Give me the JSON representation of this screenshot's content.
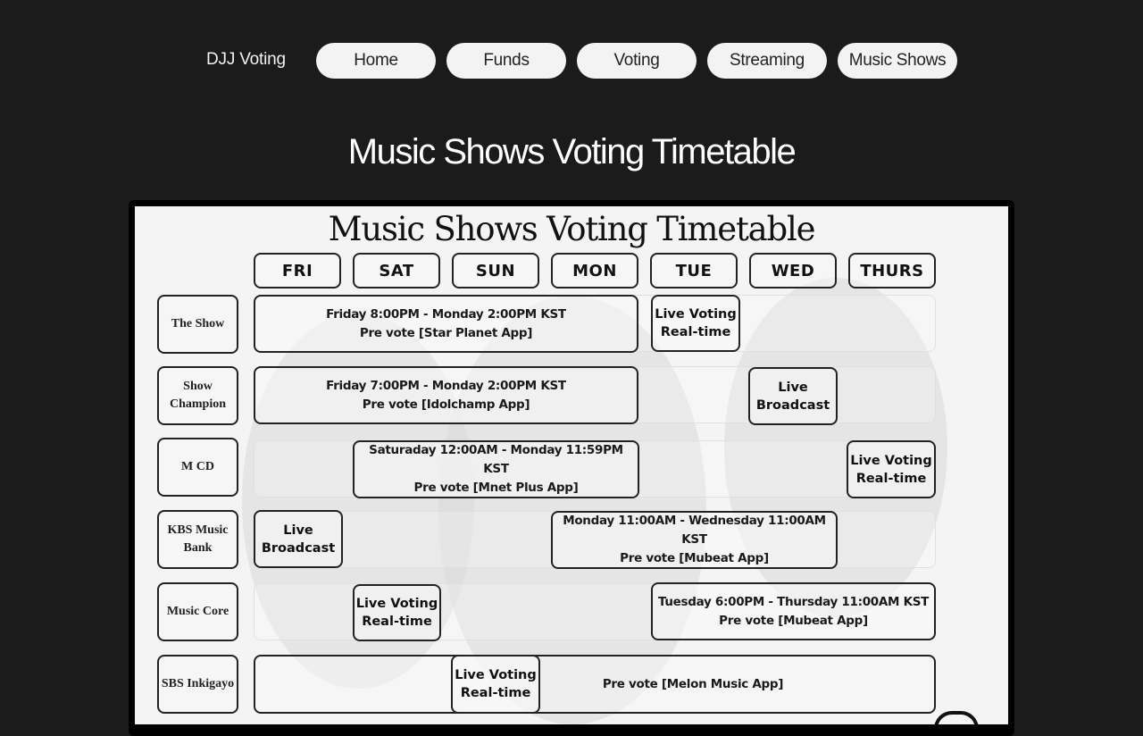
{
  "nav": {
    "brand": "DJJ Voting",
    "items": [
      {
        "label": "Home"
      },
      {
        "label": "Funds"
      },
      {
        "label": "Voting"
      },
      {
        "label": "Streaming"
      },
      {
        "label": "Music Shows"
      }
    ]
  },
  "page": {
    "title": "Music Shows Voting Timetable"
  },
  "poster": {
    "title": "Music Shows Voting Timetable",
    "days": [
      "FRI",
      "SAT",
      "SUN",
      "MON",
      "TUE",
      "WED",
      "THURS"
    ],
    "shows": [
      {
        "name": "The Show",
        "prevote": {
          "line1": "Friday 8:00PM - Monday 2:00PM KST",
          "line2": "Pre vote [Star Planet App]"
        },
        "live": {
          "line1": "Live Voting",
          "line2": "Real-time"
        }
      },
      {
        "name_line1": "Show",
        "name_line2": "Champion",
        "prevote": {
          "line1": "Friday 7:00PM - Monday 2:00PM KST",
          "line2": "Pre vote [Idolchamp App]"
        },
        "live": {
          "line1": "Live",
          "line2": "Broadcast"
        }
      },
      {
        "name": "M CD",
        "prevote": {
          "line1": "Saturaday 12:00AM - Monday 11:59PM KST",
          "line2": "Pre vote [Mnet Plus App]"
        },
        "live": {
          "line1": "Live Voting",
          "line2": "Real-time"
        }
      },
      {
        "name_line1": "KBS Music",
        "name_line2": "Bank",
        "live": {
          "line1": "Live",
          "line2": "Broadcast"
        },
        "prevote": {
          "line1": "Monday 11:00AM - Wednesday 11:00AM KST",
          "line2": "Pre vote [Mubeat App]"
        }
      },
      {
        "name": "Music Core",
        "live": {
          "line1": "Live Voting",
          "line2": "Real-time"
        },
        "prevote": {
          "line1": "Tuesday 6:00PM - Thursday 11:00AM KST",
          "line2": "Pre vote [Mubeat App]"
        }
      },
      {
        "name": "SBS Inkigayo",
        "live": {
          "line1": "Live Voting",
          "line2": "Real-time"
        },
        "prevote": {
          "line1": "Pre vote [Melon Music App]"
        }
      }
    ]
  }
}
